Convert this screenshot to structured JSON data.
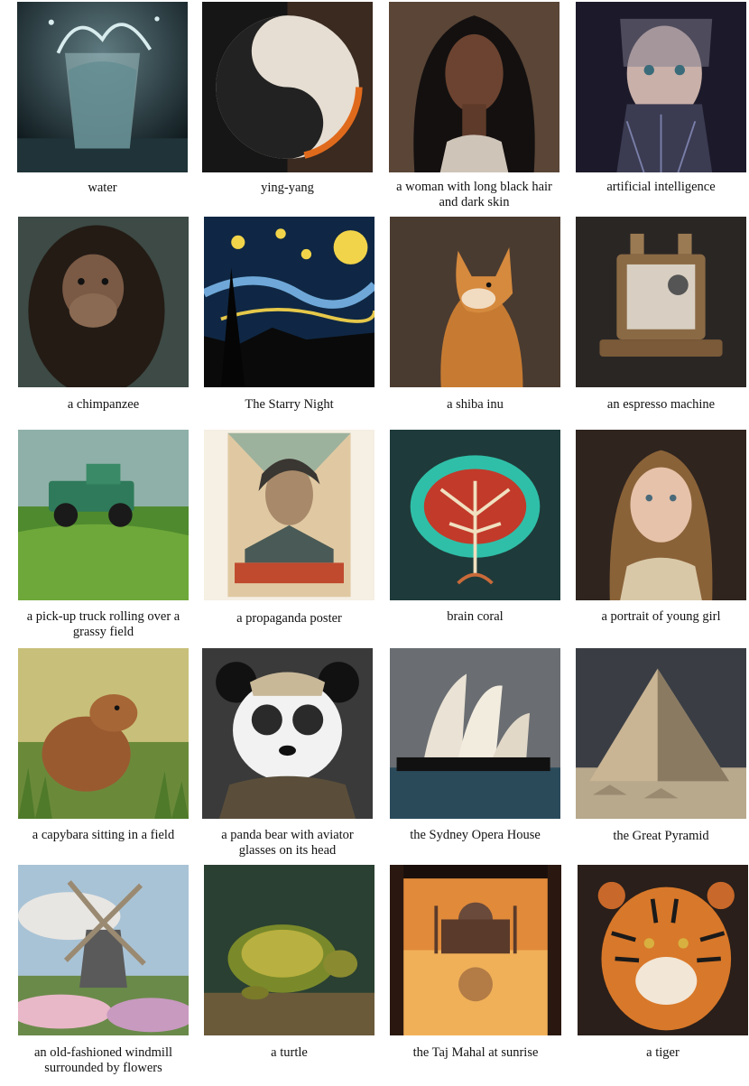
{
  "grid": {
    "items": [
      {
        "caption": "water",
        "icon": "water-glass-splash"
      },
      {
        "caption": "ying-yang",
        "icon": "yin-yang-symbol"
      },
      {
        "caption": "a woman with long black hair and dark skin",
        "icon": "woman-portrait"
      },
      {
        "caption": "artificial intelligence",
        "icon": "cyborg-face"
      },
      {
        "caption": "a chimpanzee",
        "icon": "chimpanzee"
      },
      {
        "caption": "The Starry Night",
        "icon": "starry-night-painting"
      },
      {
        "caption": "a shiba inu",
        "icon": "shiba-inu-dog"
      },
      {
        "caption": "an espresso machine",
        "icon": "espresso-machine"
      },
      {
        "caption": "a pick-up truck rolling over a grassy field",
        "icon": "green-pickup-truck"
      },
      {
        "caption": "a propaganda poster",
        "icon": "propaganda-poster"
      },
      {
        "caption": "brain coral",
        "icon": "brain-coral-tree"
      },
      {
        "caption": "a portrait of young girl",
        "icon": "girl-portrait"
      },
      {
        "caption": "a capybara sitting in a field",
        "icon": "capybara"
      },
      {
        "caption": "a panda bear with aviator glasses on its head",
        "icon": "panda-aviator"
      },
      {
        "caption": "the Sydney Opera House",
        "icon": "sydney-opera-house"
      },
      {
        "caption": "the Great Pyramid",
        "icon": "great-pyramid"
      },
      {
        "caption": "an old-fashioned windmill surrounded by flowers",
        "icon": "windmill-flowers"
      },
      {
        "caption": "a turtle",
        "icon": "turtle"
      },
      {
        "caption": "the Taj Mahal at sunrise",
        "icon": "taj-mahal-sunrise"
      },
      {
        "caption": "a tiger",
        "icon": "tiger"
      }
    ]
  }
}
